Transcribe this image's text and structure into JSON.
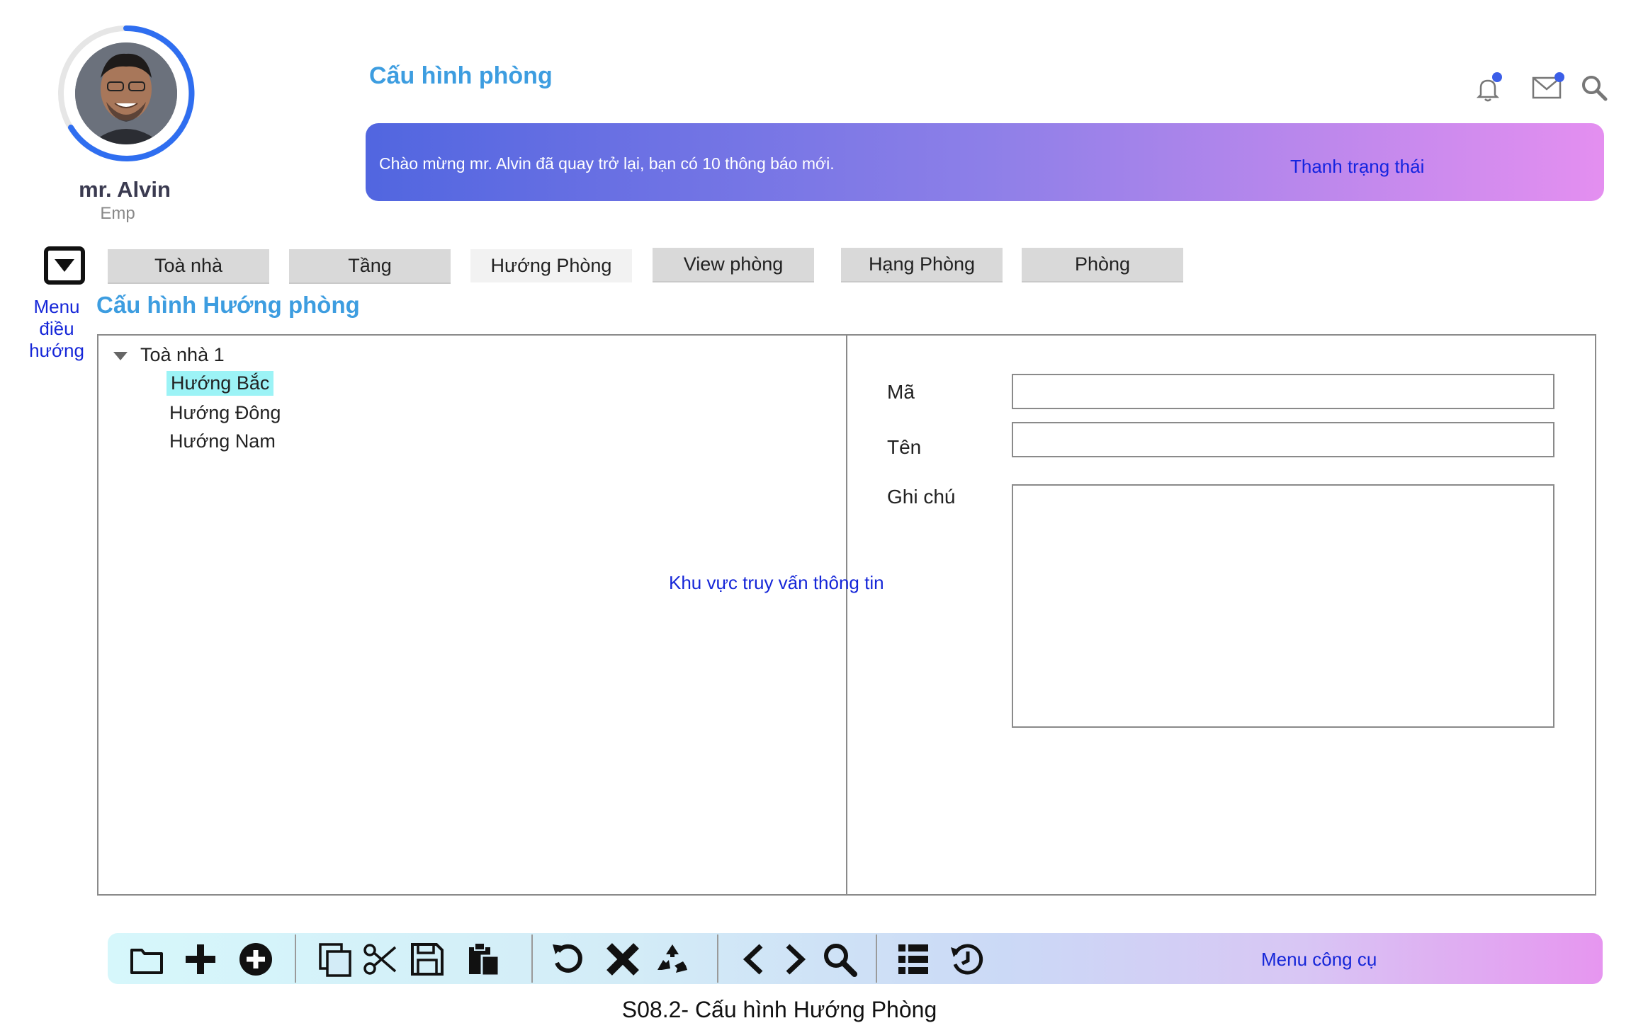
{
  "header": {
    "page_title": "Cấu hình phòng",
    "user": {
      "name": "mr. Alvin",
      "role": "Emp"
    },
    "banner_message": "Chào mừng mr. Alvin đã quay trở lại, bạn có 10 thông báo mới.",
    "status_label": "Thanh trạng thái",
    "icons": [
      "bell-icon",
      "mail-icon",
      "search-icon"
    ]
  },
  "nav": {
    "menu_label": "Menu điều hướng",
    "tabs": [
      {
        "label": "Toà nhà",
        "active": false
      },
      {
        "label": "Tầng",
        "active": false
      },
      {
        "label": "Hướng Phòng",
        "active": true
      },
      {
        "label": "View phòng",
        "active": false
      },
      {
        "label": "Hạng Phòng",
        "active": false
      },
      {
        "label": "Phòng",
        "active": false
      }
    ]
  },
  "main": {
    "section_title": "Cấu hình Hướng phòng",
    "tree": {
      "root": "Toà nhà 1",
      "items": [
        {
          "label": "Hướng Bắc",
          "selected": true
        },
        {
          "label": "Hướng Đông",
          "selected": false
        },
        {
          "label": "Hướng Nam",
          "selected": false
        }
      ]
    },
    "query_area_label": "Khu vực truy vấn thông tin",
    "form": {
      "code_label": "Mã",
      "code_value": "",
      "name_label": "Tên",
      "name_value": "",
      "notes_label": "Ghi chú",
      "notes_value": ""
    }
  },
  "toolbar": {
    "label": "Menu công cụ",
    "icons": [
      "folder-icon",
      "plus-icon",
      "plus-circle-icon",
      "copy-icon",
      "scissors-icon",
      "save-icon",
      "paste-icon",
      "undo-icon",
      "close-icon",
      "recycle-icon",
      "chevron-left-icon",
      "chevron-right-icon",
      "search-icon",
      "list-icon",
      "history-icon"
    ]
  },
  "caption": "S08.2- Cấu hình Hướng Phòng",
  "colors": {
    "accent": "#3d9de0",
    "link": "#1526d8",
    "banner_start": "#5166e0",
    "banner_end": "#e48ff0",
    "selected_bg": "#9cf3f6"
  }
}
